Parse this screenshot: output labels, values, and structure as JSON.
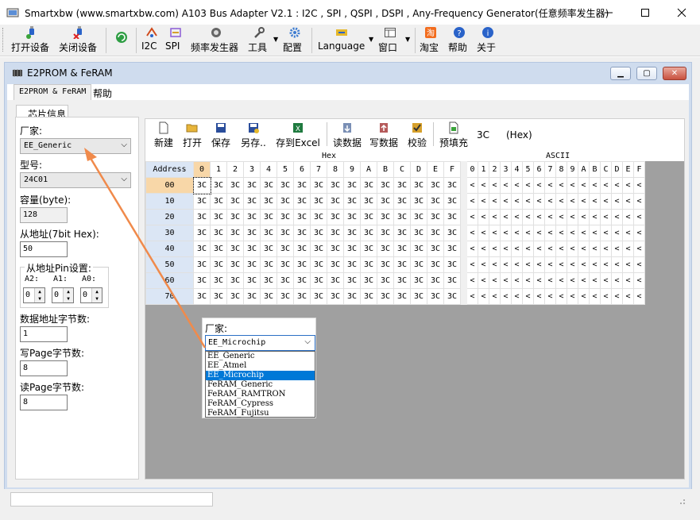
{
  "window": {
    "title": "Smartxbw (www.smartxbw.com) A103 Bus Adapter V2.1 : I2C , SPI , QSPI , DSPI , Any-Frequency Generator(任意频率发生器)"
  },
  "toolbar": {
    "items": [
      {
        "label": "打开设备",
        "icon": "plug-connect-icon"
      },
      {
        "label": "关闭设备",
        "icon": "plug-disconnect-icon"
      },
      {
        "label": "",
        "icon": "refresh-icon"
      },
      {
        "label": "I2C",
        "icon": "i2c-icon"
      },
      {
        "label": "SPI",
        "icon": "spi-icon"
      },
      {
        "label": "频率发生器",
        "icon": "frequency-icon"
      },
      {
        "label": "工具",
        "icon": "wrench-icon"
      },
      {
        "label": "配置",
        "icon": "gear-icon"
      },
      {
        "label": "Language",
        "icon": "language-icon"
      },
      {
        "label": "窗口",
        "icon": "window-icon"
      },
      {
        "label": "淘宝",
        "icon": "taobao-icon"
      },
      {
        "label": "帮助",
        "icon": "help-icon"
      },
      {
        "label": "关于",
        "icon": "info-icon"
      }
    ]
  },
  "child": {
    "title": "E2PROM & FeRAM",
    "menu": [
      "E2PROM & FeRAM",
      "帮助"
    ]
  },
  "left": {
    "tab": "芯片信息",
    "vendor_label": "厂家:",
    "vendor_value": "EE_Generic",
    "model_label": "型号:",
    "model_value": "24C01",
    "capacity_label": "容量(byte):",
    "capacity_value": "128",
    "slave_label": "从地址(7bit Hex):",
    "slave_value": "50",
    "pin_group_label": "从地址Pin设置:",
    "pins": [
      {
        "label": "A2:",
        "value": "0"
      },
      {
        "label": "A1:",
        "value": "0"
      },
      {
        "label": "A0:",
        "value": "0"
      }
    ],
    "addr_bytes_label": "数据地址字节数:",
    "addr_bytes_value": "1",
    "write_page_label": "写Page字节数:",
    "write_page_value": "8",
    "read_page_label": "读Page字节数:",
    "read_page_value": "8"
  },
  "editor_toolbar": {
    "new": "新建",
    "open": "打开",
    "save": "保存",
    "save_as": "另存..",
    "export": "存到Excel",
    "read": "读数据",
    "write": "写数据",
    "verify": "校验",
    "prefill": "预填充",
    "fill_value": "3C",
    "fill_unit": "(Hex)"
  },
  "grid": {
    "hex_group": "Hex",
    "ascii_group": "ASCII",
    "address_header": "Address",
    "hex_cols": [
      "0",
      "1",
      "2",
      "3",
      "4",
      "5",
      "6",
      "7",
      "8",
      "9",
      "A",
      "B",
      "C",
      "D",
      "E",
      "F"
    ],
    "ascii_cols": [
      "0",
      "1",
      "2",
      "3",
      "4",
      "5",
      "6",
      "7",
      "8",
      "9",
      "A",
      "B",
      "C",
      "D",
      "E",
      "F"
    ],
    "rows": [
      "00",
      "10",
      "20",
      "30",
      "40",
      "50",
      "60",
      "70"
    ],
    "cell_value": "3C",
    "ascii_value": "<"
  },
  "popup": {
    "label": "厂家:",
    "selected": "EE_Microchip",
    "options": [
      "EE_Generic",
      "EE_Atmel",
      "EE_Microchip",
      "FeRAM_Generic",
      "FeRAM_RAMTRON",
      "FeRAM_Cypress",
      "FeRAM_Fujitsu"
    ],
    "selected_index": 2
  },
  "colors": {
    "selection": "#0078d7",
    "address_bg": "#dbe6f5",
    "address_selected": "#f8d7a8",
    "arrow": "#f08a4b"
  }
}
